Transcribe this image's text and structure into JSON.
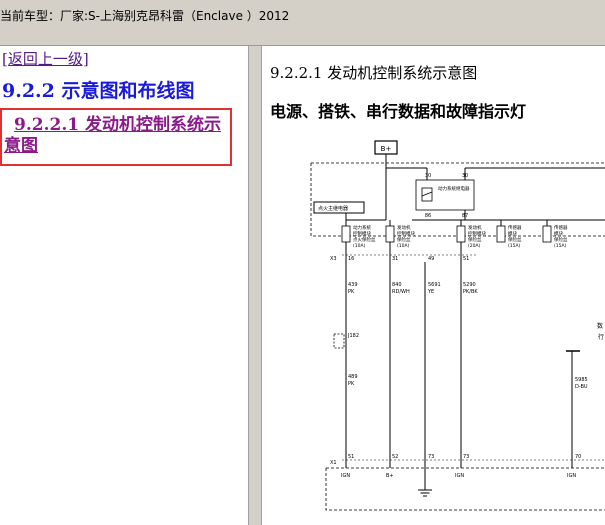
{
  "window": {
    "title": "当前车型：厂家:S-上海别克昂科雷（Enclave ）2012"
  },
  "nav": {
    "back_link": "[返回上一级]",
    "section_heading": "9.2.2 示意图和布线图",
    "toc_item": "9.2.2.1 发动机控制系统示意图"
  },
  "document": {
    "title": "9.2.2.1 发动机控制系统示意图",
    "subtitle": "电源、搭铁、串行数据和故障指示灯"
  },
  "diagram": {
    "battery_label": "B+",
    "fuse_block_label": "点火主继电器",
    "relay": {
      "pin_top_left": "30",
      "pin_top_right": "30",
      "label": "动力系统继电器",
      "pin_bottom_left": "86",
      "pin_bottom_right": "87"
    },
    "fuses": [
      {
        "text1": "动力系统",
        "text2": "控制模块",
        "text3": "点火保险丝",
        "rating": "(10A)",
        "pin": "16"
      },
      {
        "text1": "发动机",
        "text2": "控制模块",
        "text3": "保险丝",
        "rating": "(10A)",
        "pin": "31"
      },
      {
        "text1": "发动机",
        "text2": "控制模块",
        "text3": "保险丝",
        "rating": "(20A)",
        "pin": "51"
      },
      {
        "text1": "传感器",
        "text2": "模块",
        "text3": "保险丝",
        "rating": "(15A)",
        "pin": ""
      },
      {
        "text1": "传感器",
        "text2": "模块",
        "text3": "保险丝",
        "rating": "(15A)",
        "pin": ""
      }
    ],
    "connector_top": "X3",
    "extra_pin": "49",
    "wires": [
      {
        "circuit": "439",
        "color": "PK"
      },
      {
        "circuit": "840",
        "color": "RD/WH"
      },
      {
        "circuit": "5691",
        "color": "YE"
      },
      {
        "circuit": "5290",
        "color": "PK/BK"
      }
    ],
    "splice": "J182",
    "lower_wire": {
      "circuit": "489",
      "color": "PK"
    },
    "right_wire": {
      "circuit": "5985",
      "color": "D-BU"
    },
    "connector_bottom": "X1",
    "bottom_pins": [
      "51",
      "52",
      "73",
      "73",
      "70"
    ],
    "ecm_labels": [
      "IGN",
      "B+",
      "IGN",
      "IGN"
    ],
    "right_cut_text": [
      "数",
      "行"
    ]
  }
}
